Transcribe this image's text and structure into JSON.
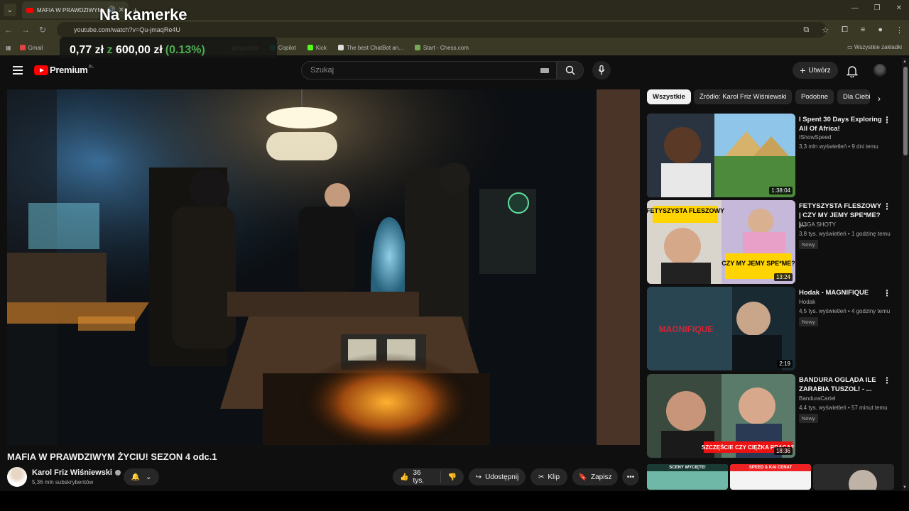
{
  "browser": {
    "tab_title": "MAFIA W PRAWDZIWYM Ż",
    "url": "youtube.com/watch?v=Qu-jmaqRe4U",
    "bookmarks": [
      "Gmail",
      "geoguessr",
      "Copilot",
      "Kick",
      "The best ChatBot an...",
      "Start - Chess.com"
    ],
    "bookmarks_right": "Wszystkie zakładki"
  },
  "overlay": {
    "title": "Na kamerke",
    "amount": "0,77 zł",
    "of_word": "z",
    "goal": "600,00 zł",
    "percent": "(0.13%)"
  },
  "header": {
    "logo_text": "Premium",
    "logo_country": "PL",
    "search_placeholder": "Szukaj",
    "create_label": "Utwórz"
  },
  "video": {
    "title": "MAFIA W PRAWDZIWYM ŻYCIU! SEZON 4 odc.1",
    "channel": "Karol Friz Wiśniewski",
    "subscribers": "5,36 mln subskrybentów",
    "likes": "36 tys.",
    "share_label": "Udostępnij",
    "clip_label": "Klip",
    "save_label": "Zapisz"
  },
  "chips": [
    "Wszystkie",
    "Źródło: Karol Friz Wiśniewski",
    "Podobne",
    "Dla Ciebie"
  ],
  "recommendations": [
    {
      "title": "I Spent 30 Days Exploring All Of Africa!",
      "channel": "IShowSpeed",
      "meta": "3,3 mln wyświetleń • 9 dni temu",
      "duration": "1:38:04",
      "badge": ""
    },
    {
      "title": "FETYSZYSTA FLESZOWY | CZY MY JEMY SPE*ME? |...",
      "channel": "M3GA SHOTY",
      "meta": "3,8 tys. wyświetleń • 1 godzinę temu",
      "duration": "13:24",
      "badge": "Nowy"
    },
    {
      "title": "Hodak - MAGNIFIQUE",
      "channel": "Hodak",
      "meta": "4,5 tys. wyświetleń • 4 godziny temu",
      "duration": "2:19",
      "badge": "Nowy"
    },
    {
      "title": "BANDURA OGLĄDA ILE ZARABIA TUSZOL! - ...",
      "channel": "BanduraCartel",
      "meta": "4,4 tys. wyświetleń • 57 minut temu",
      "duration": "18:36",
      "badge": "Nowy"
    }
  ],
  "thumb_texts": {
    "rec2_top": "FETYSZYSTA FLESZOWY",
    "rec2_bottom": "CZY MY JEMY SPE*ME?",
    "rec3": "MAGNIFIQUE",
    "rec4": "SZCZĘŚCIE CZY CIĘŻKA PRACA?",
    "small1": "SCENY WYCIĘTE!",
    "small2": "SPEED & KAI CENAT"
  }
}
